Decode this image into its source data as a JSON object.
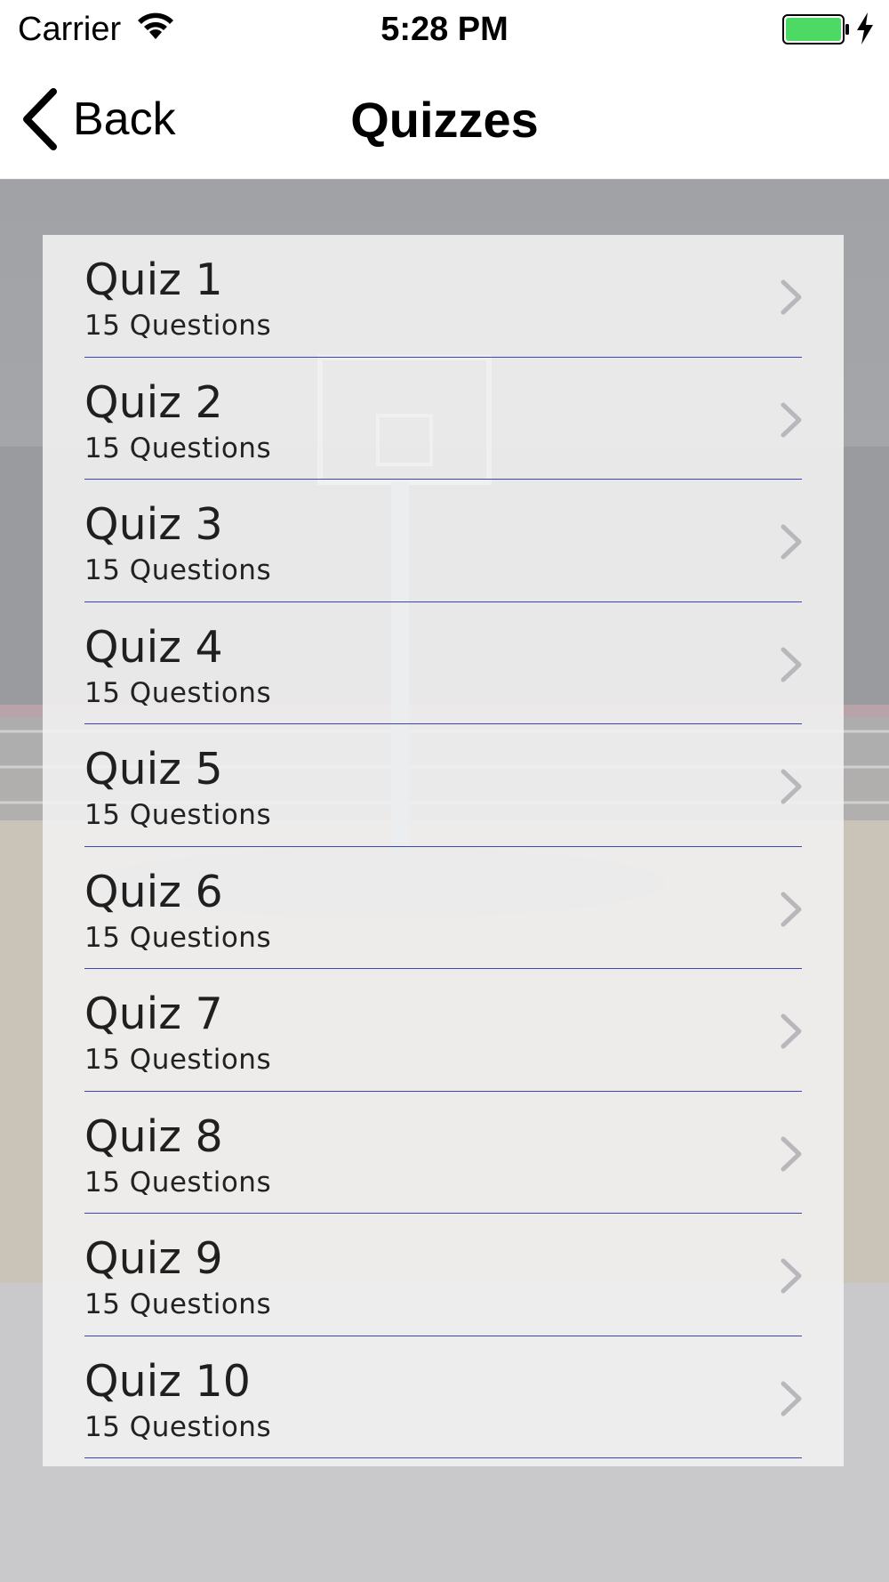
{
  "status_bar": {
    "carrier": "Carrier",
    "time": "5:28 PM",
    "icons": [
      "wifi-icon",
      "battery-icon",
      "charging-bolt-icon"
    ],
    "battery_color": "#4cd964"
  },
  "nav": {
    "back_label": "Back",
    "title": "Quizzes"
  },
  "quizzes": [
    {
      "title": "Quiz 1",
      "subtitle": "15 Questions"
    },
    {
      "title": "Quiz 2",
      "subtitle": "15 Questions"
    },
    {
      "title": "Quiz 3",
      "subtitle": "15 Questions"
    },
    {
      "title": "Quiz 4",
      "subtitle": "15 Questions"
    },
    {
      "title": "Quiz 5",
      "subtitle": "15 Questions"
    },
    {
      "title": "Quiz 6",
      "subtitle": "15 Questions"
    },
    {
      "title": "Quiz 7",
      "subtitle": "15 Questions"
    },
    {
      "title": "Quiz 8",
      "subtitle": "15 Questions"
    },
    {
      "title": "Quiz 9",
      "subtitle": "15 Questions"
    },
    {
      "title": "Quiz 10",
      "subtitle": "15 Questions"
    }
  ],
  "colors": {
    "separator": "#3d44b8",
    "chevron": "#b8b8bc"
  }
}
